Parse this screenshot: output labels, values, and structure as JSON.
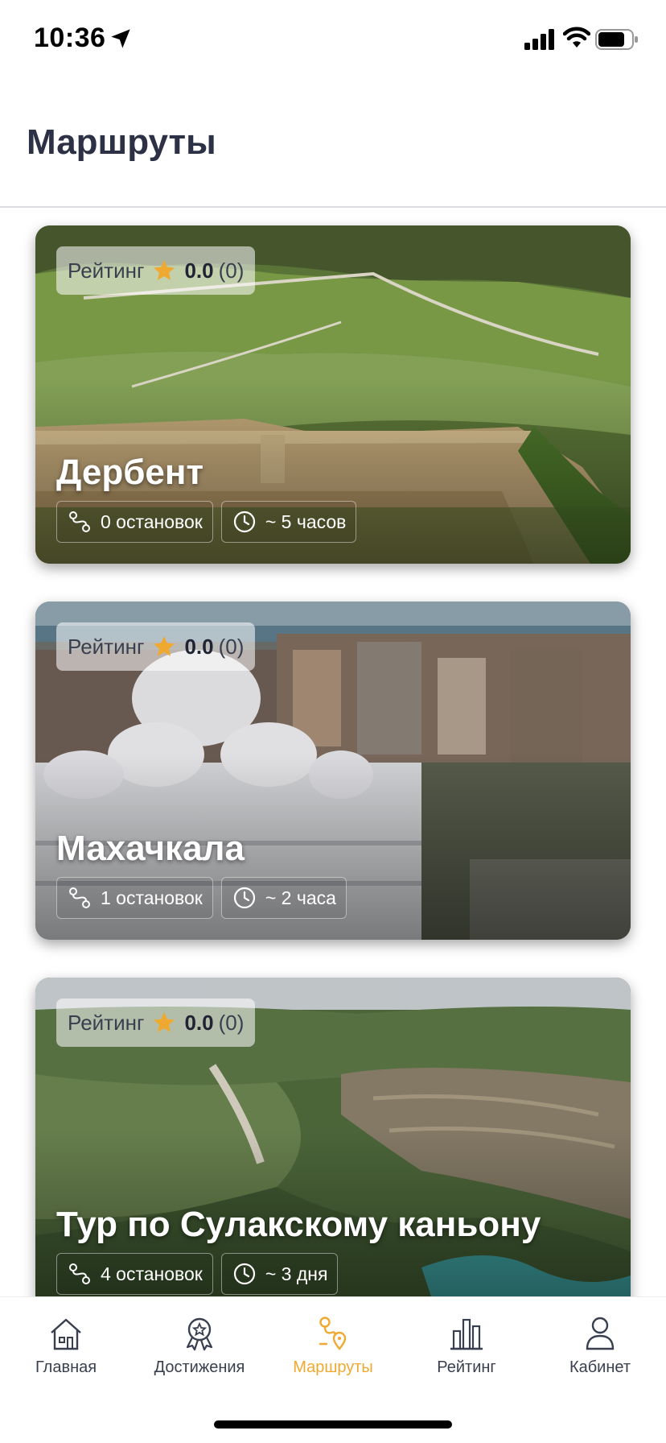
{
  "status_bar": {
    "time": "10:36"
  },
  "header": {
    "title": "Маршруты"
  },
  "colors": {
    "accent": "#f0a930",
    "text": "#2c3145"
  },
  "routes": [
    {
      "rating_label": "Рейтинг",
      "rating_value": "0.0",
      "rating_count": "(0)",
      "title": "Дербент",
      "stops": "0 остановок",
      "duration": "~ 5 часов"
    },
    {
      "rating_label": "Рейтинг",
      "rating_value": "0.0",
      "rating_count": "(0)",
      "title": "Махачкала",
      "stops": "1 остановок",
      "duration": "~ 2 часа"
    },
    {
      "rating_label": "Рейтинг",
      "rating_value": "0.0",
      "rating_count": "(0)",
      "title": "Тур по Сулакскому каньону",
      "stops": "4 остановок",
      "duration": "~ 3 дня"
    }
  ],
  "tabs": [
    {
      "label": "Главная",
      "icon": "home-icon",
      "active": false
    },
    {
      "label": "Достижения",
      "icon": "achievements-icon",
      "active": false
    },
    {
      "label": "Маршруты",
      "icon": "routes-icon",
      "active": true
    },
    {
      "label": "Рейтинг",
      "icon": "rating-chart-icon",
      "active": false
    },
    {
      "label": "Кабинет",
      "icon": "profile-icon",
      "active": false
    }
  ]
}
